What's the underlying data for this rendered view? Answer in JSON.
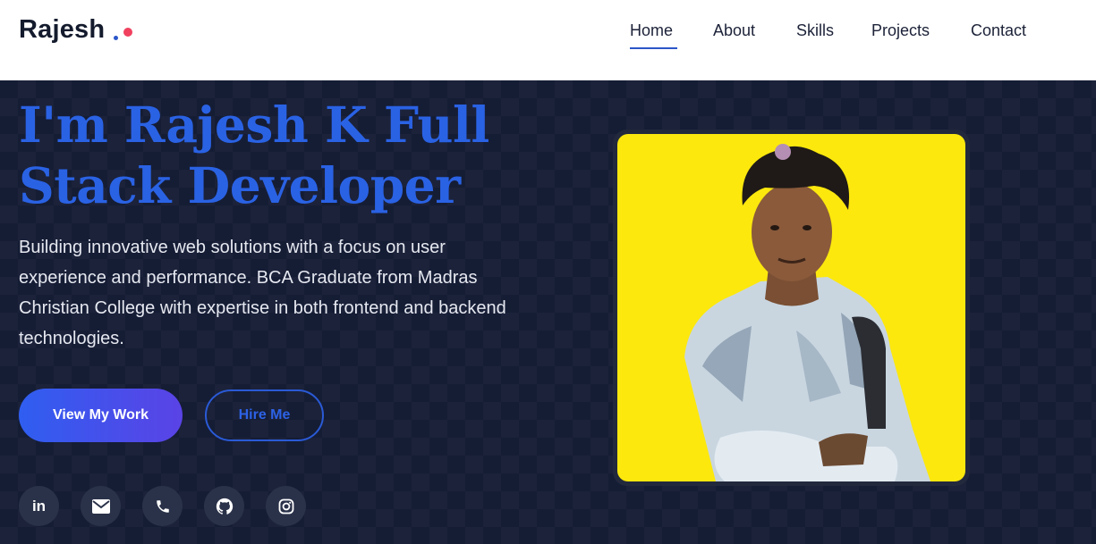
{
  "header": {
    "logo_text": "Rajesh",
    "logo_dot_colors": {
      "blue": "#2b56c9",
      "pink": "#f0415f"
    },
    "nav": [
      {
        "label": "Home",
        "active": true
      },
      {
        "label": "About",
        "active": false
      },
      {
        "label": "Skills",
        "active": false
      },
      {
        "label": "Projects",
        "active": false
      },
      {
        "label": "Contact",
        "active": false
      }
    ]
  },
  "hero": {
    "title": "I'm Rajesh K Full Stack Developer",
    "description": "Building innovative web solutions with a focus on user experience and performance. BCA Graduate from Madras Christian College with expertise in both frontend and backend technologies.",
    "primary_button": "View My Work",
    "secondary_button": "Hire Me",
    "social_icons": [
      "linkedin-icon",
      "envelope-icon",
      "phone-icon",
      "github-icon",
      "instagram-icon"
    ]
  },
  "colors": {
    "accent": "#2a62e4",
    "hero_bg": "#151d35",
    "photo_bg": "#fce80d"
  }
}
